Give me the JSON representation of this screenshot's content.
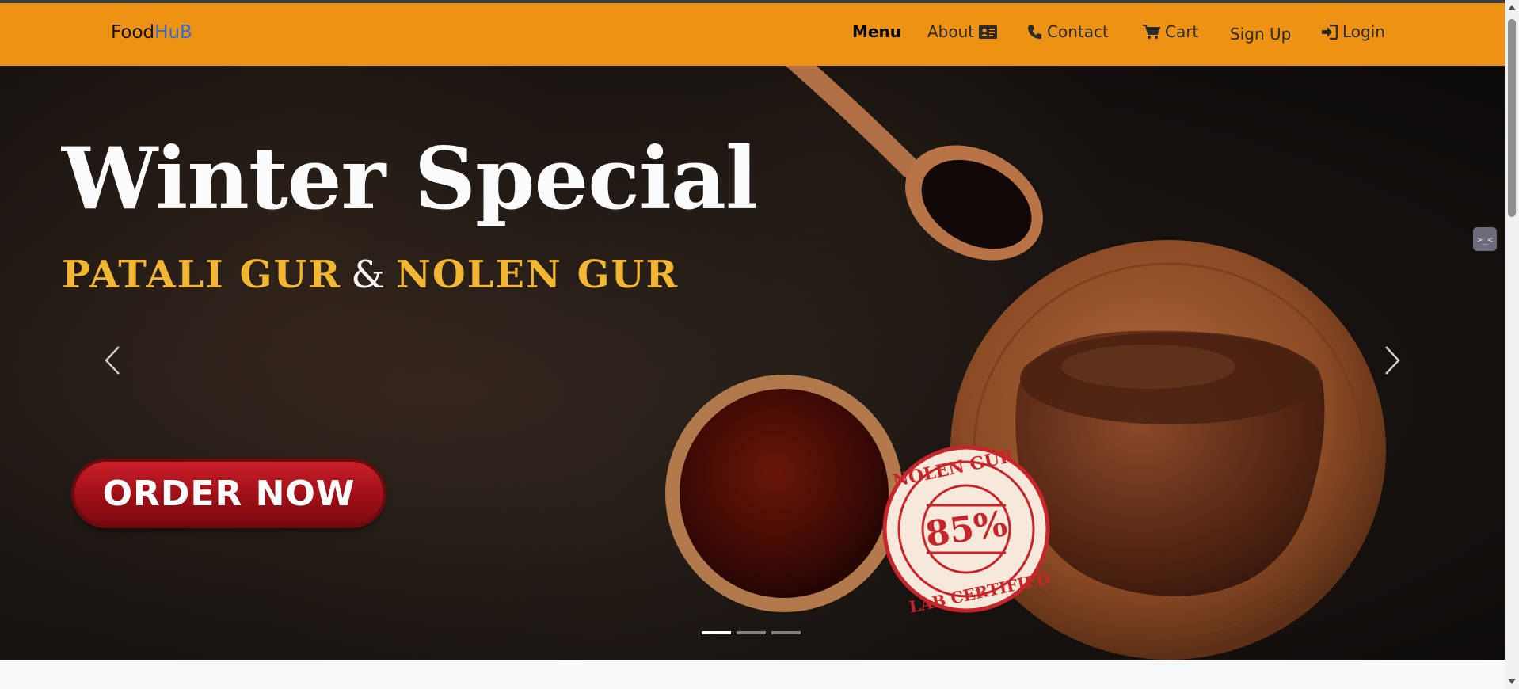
{
  "brand": {
    "part1": "Food",
    "part2": "HuB"
  },
  "nav": {
    "menu": "Menu",
    "about": "About",
    "contact": "Contact",
    "cart": "Cart",
    "signup": "Sign Up",
    "login": "Login"
  },
  "hero": {
    "title": "Winter Special",
    "sub1": "PATALI GUR",
    "amp": "&",
    "sub2": "NOLEN GUR",
    "cta": "ORDER NOW",
    "stamp_top": "NOLEN GUR",
    "stamp_value": "85%",
    "stamp_bottom": "LAB CERTIFIED"
  },
  "carousel": {
    "slides": 3,
    "active_index": 0
  },
  "colors": {
    "navbar": "#ee9213",
    "brand_accent": "#2f6fd6",
    "subtitle": "#f2b633",
    "cta": "#b3141c"
  },
  "extension": {
    "label": ">_<"
  }
}
